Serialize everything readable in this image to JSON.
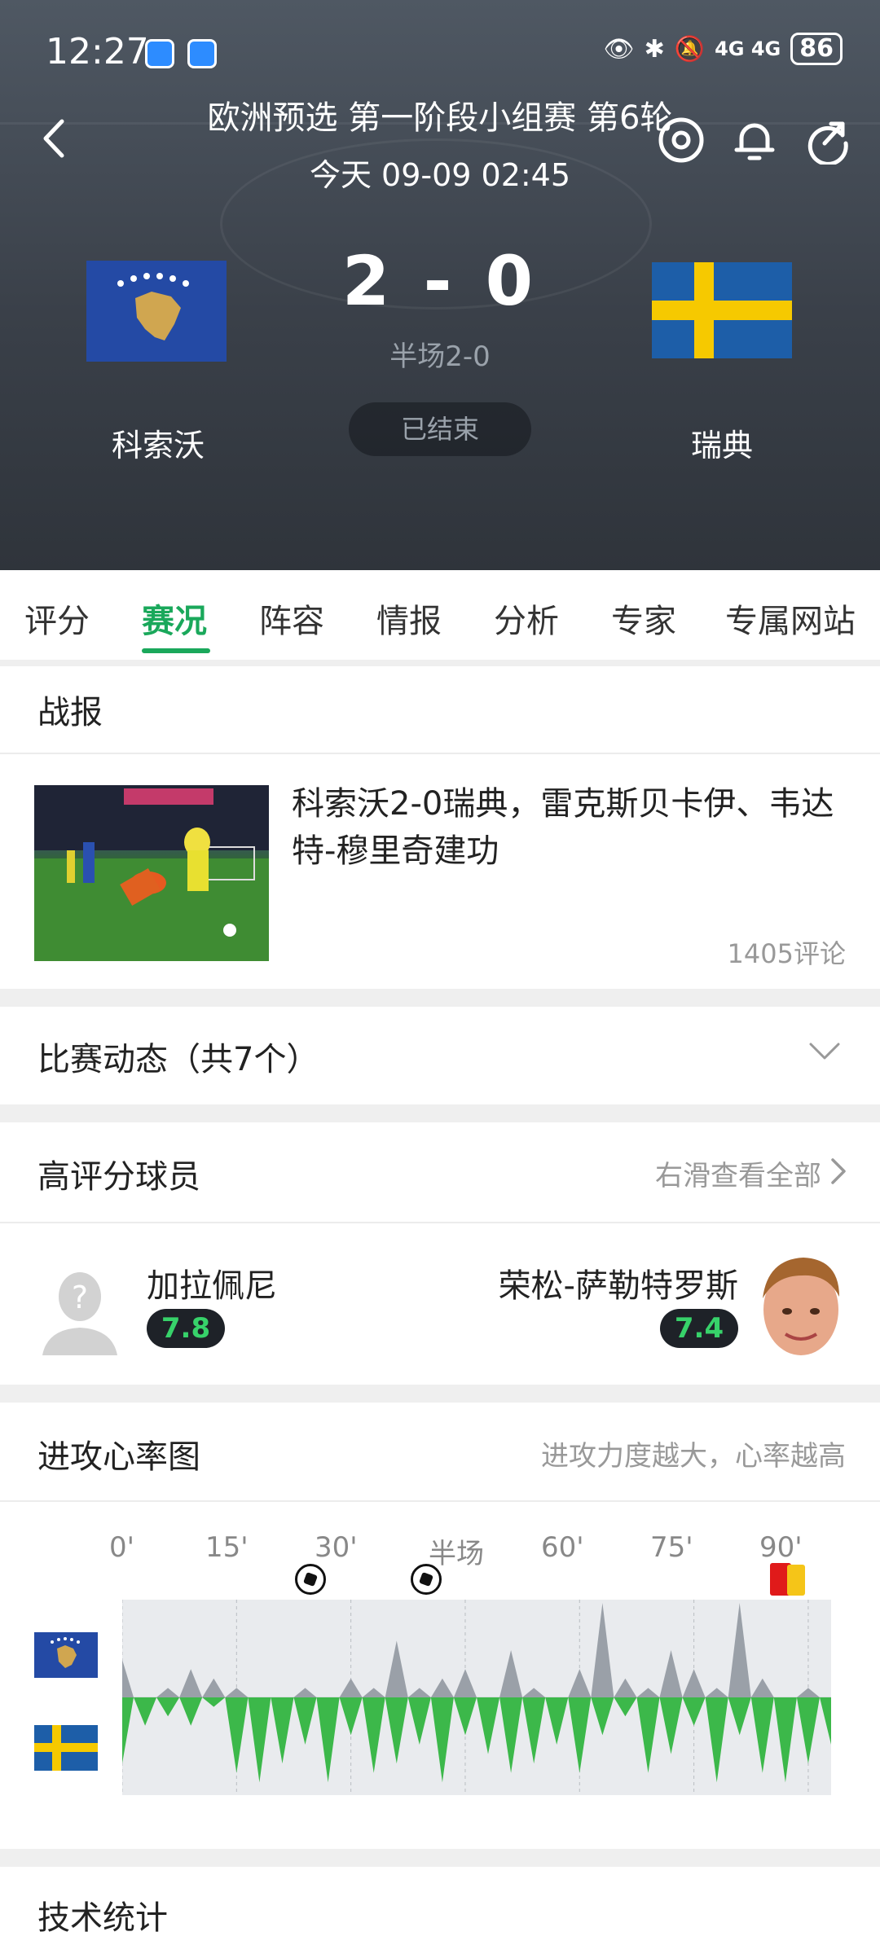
{
  "status_bar": {
    "time": "12:27",
    "network": "4G 4G",
    "battery": "86"
  },
  "match": {
    "competition": "欧洲预选 第一阶段小组赛 第6轮",
    "datetime": "今天 09-09 02:45",
    "score": "2 - 0",
    "halftime": "半场2-0",
    "status": "已结束",
    "home_team": "科索沃",
    "away_team": "瑞典"
  },
  "tabs": [
    {
      "label": "评分"
    },
    {
      "label": "赛况"
    },
    {
      "label": "阵容"
    },
    {
      "label": "情报"
    },
    {
      "label": "分析"
    },
    {
      "label": "专家"
    },
    {
      "label": "专属网站"
    }
  ],
  "report": {
    "title": "战报",
    "headline": "科索沃2-0瑞典，雷克斯贝卡伊、韦达特-穆里奇建功",
    "comments": "1405评论"
  },
  "events": {
    "title": "比赛动态（共7个）"
  },
  "top_players": {
    "title": "高评分球员",
    "link": "右滑查看全部",
    "home": {
      "name": "加拉佩尼",
      "rating": "7.8"
    },
    "away": {
      "name": "荣松-萨勒特罗斯",
      "rating": "7.4"
    }
  },
  "attack_chart": {
    "title": "进攻心率图",
    "subtitle": "进攻力度越大，心率越高",
    "ticks": [
      "0'",
      "15'",
      "30'",
      "半场",
      "60'",
      "75'",
      "90'"
    ]
  },
  "tech_stats": {
    "title": "技术统计"
  },
  "chart_data": {
    "type": "area",
    "x": [
      0,
      3,
      6,
      9,
      12,
      15,
      18,
      21,
      24,
      27,
      30,
      33,
      36,
      39,
      42,
      45,
      48,
      51,
      54,
      57,
      60,
      63,
      66,
      69,
      72,
      75,
      78,
      81,
      84,
      87,
      90,
      93
    ],
    "series": [
      {
        "values": [
          0.4,
          0,
          0.1,
          0.3,
          0.2,
          0.1,
          0,
          0,
          0.1,
          0,
          0.2,
          0.1,
          0.6,
          0.1,
          0.2,
          0.3,
          0,
          0.5,
          0.1,
          0,
          0.3,
          1.0,
          0.2,
          0.1,
          0.5,
          0.3,
          0.1,
          1.0,
          0.2,
          0,
          0.1,
          0
        ]
      },
      {
        "values": [
          -0.7,
          -0.3,
          -0.2,
          -0.3,
          -0.1,
          -0.8,
          -0.9,
          -0.7,
          -0.5,
          -0.9,
          -0.4,
          -0.8,
          -0.7,
          -0.5,
          -0.9,
          -0.4,
          -0.6,
          -0.8,
          -0.7,
          -0.5,
          -0.8,
          -0.4,
          -0.2,
          -0.8,
          -0.6,
          -0.3,
          -0.9,
          -0.4,
          -0.8,
          -0.9,
          -0.7,
          -0.5
        ]
      }
    ],
    "ylim": [
      -1,
      1
    ],
    "colors": {
      "home": "#9aa0a8",
      "away": "#3cb84a"
    }
  }
}
